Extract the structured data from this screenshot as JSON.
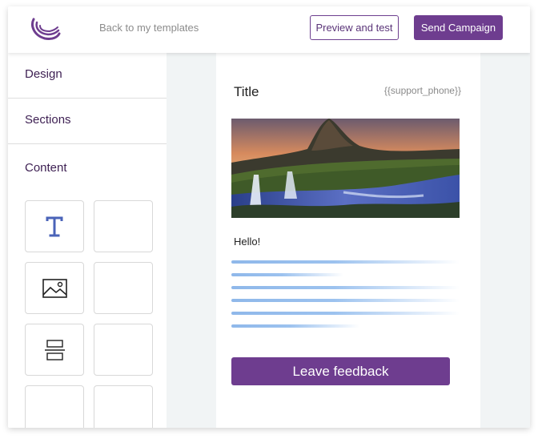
{
  "header": {
    "back_link": "Back to my templates",
    "preview_label": "Preview and test",
    "send_label": "Send Campaign"
  },
  "sidebar": {
    "items": [
      {
        "label": "Design"
      },
      {
        "label": "Sections"
      },
      {
        "label": "Content"
      }
    ],
    "tiles": [
      {
        "icon": "text-icon"
      },
      {
        "icon": ""
      },
      {
        "icon": "image-icon"
      },
      {
        "icon": ""
      },
      {
        "icon": "divider-icon"
      },
      {
        "icon": ""
      },
      {
        "icon": ""
      },
      {
        "icon": ""
      }
    ]
  },
  "email": {
    "title": "Title",
    "phone_placeholder": "{{support_phone}}",
    "hero_image": "waterfall-mountain-landscape",
    "greeting": "Hello!",
    "feedback_button": "Leave feedback"
  },
  "colors": {
    "brand_purple": "#6e3d8f",
    "sidebar_text": "#3d1f52",
    "text_line_blue": "#8fb8ea",
    "canvas_bg": "#f1f4f5"
  }
}
